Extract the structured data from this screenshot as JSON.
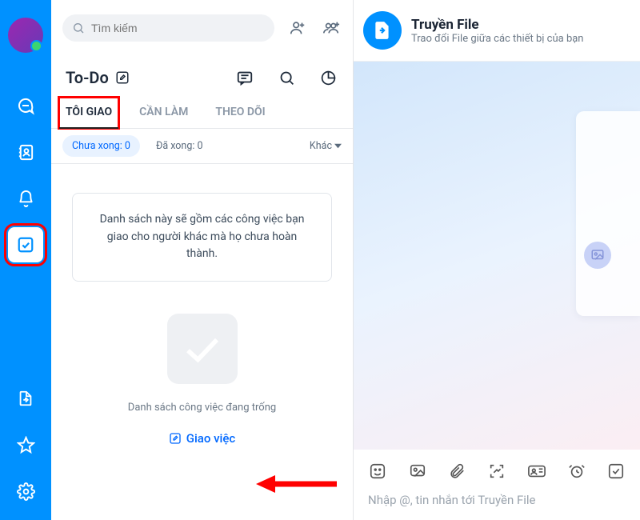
{
  "search": {
    "placeholder": "Tìm kiếm"
  },
  "todo": {
    "title": "To-Do",
    "tabs": {
      "mine": "TÔI GIAO",
      "need": "CẦN LÀM",
      "follow": "THEO DÕI"
    },
    "filters": {
      "pending": "Chưa xong: 0",
      "done": "Đã xong: 0",
      "more": "Khác"
    },
    "info": "Danh sách này sẽ gồm các công việc bạn giao cho người khác mà họ chưa hoàn thành.",
    "empty": "Danh sách công việc đang trống",
    "assign": "Giao việc"
  },
  "chat": {
    "title": "Truyền File",
    "sub": "Trao đổi File giữa các thiết bị của bạn",
    "compose": "Nhập @, tin nhắn tới Truyền File"
  }
}
